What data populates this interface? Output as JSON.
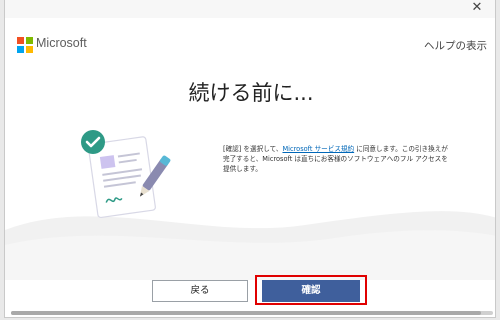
{
  "window": {
    "close_glyph": "✕"
  },
  "brand": {
    "name": "Microsoft",
    "logo_colors": [
      "#f25022",
      "#7fba00",
      "#00a4ef",
      "#ffb900"
    ]
  },
  "help": {
    "label": "ヘルプの表示"
  },
  "main": {
    "title": "続ける前に...",
    "description_prefix": "[確認] を選択して、",
    "description_link": "Microsoft サービス規約",
    "description_suffix": " に同意します。この引き換えが完了すると、Microsoft は直ちにお客様のソフトウェアへのフル アクセスを提供します。"
  },
  "actions": {
    "back_label": "戻る",
    "confirm_label": "確認",
    "confirm_color": "#3f5f9c",
    "highlight_color": "#e00000"
  },
  "illustration": {
    "icon": "document-signature-icon",
    "check_color": "#2e9a86"
  }
}
